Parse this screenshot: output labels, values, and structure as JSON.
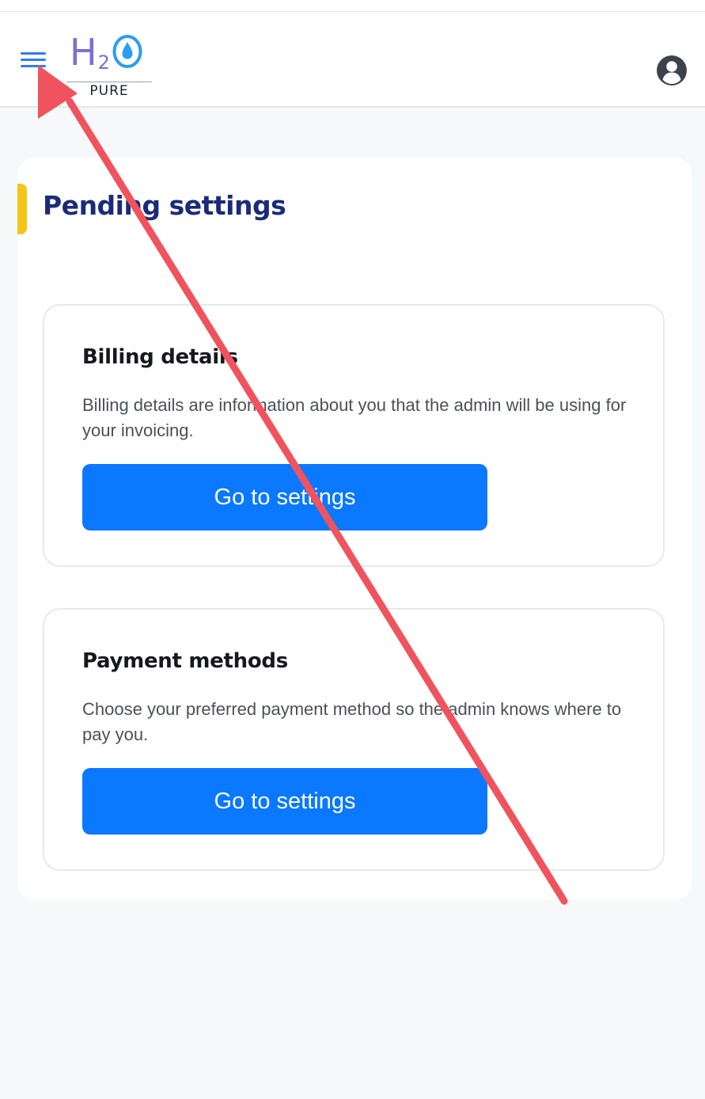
{
  "header": {
    "menu_icon": "hamburger-menu-icon",
    "logo": {
      "h": "H",
      "sub": "2",
      "o_icon": "water-drop-icon",
      "tagline": "PURE"
    },
    "profile_icon": "user-avatar-icon"
  },
  "main": {
    "title": "Pending settings",
    "cards": [
      {
        "title": "Billing details",
        "description": "Billing details are information about you that the admin will be using for your invoicing.",
        "button_label": "Go to settings"
      },
      {
        "title": "Payment methods",
        "description": "Choose your preferred payment method so the admin knows where to pay you.",
        "button_label": "Go to settings"
      }
    ]
  },
  "annotation": {
    "icon": "red-arrow-pointer",
    "color": "#f0535e"
  },
  "colors": {
    "accent": "#0a78ff",
    "title": "#1b2b7a",
    "title_marker": "#f5c518",
    "logo": "#7b6ed8",
    "menu_icon": "#2f7cf6"
  }
}
